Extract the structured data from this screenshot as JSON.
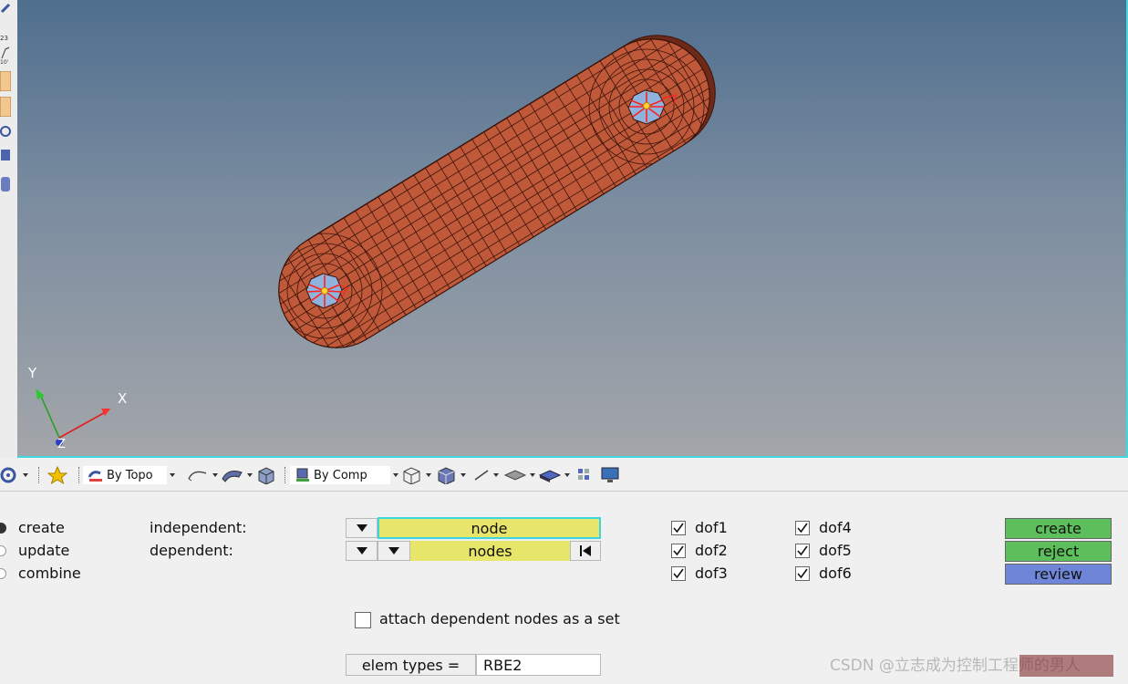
{
  "toolbar": {
    "topo_select": "By Topo",
    "comp_select": "By Comp"
  },
  "panel": {
    "modes": [
      "create",
      "update",
      "combine"
    ],
    "independent_label": "independent:",
    "dependent_label": "dependent:",
    "independent_selector": "node",
    "dependent_selector": "nodes",
    "dofs": [
      "dof1",
      "dof2",
      "dof3",
      "dof4",
      "dof5",
      "dof6"
    ],
    "buttons": {
      "create": "create",
      "reject": "reject",
      "review": "review"
    },
    "attach_label": "attach dependent nodes as a set",
    "elem_types_label": "elem types =",
    "elem_types_value": "RBE2"
  },
  "axes": {
    "x": "X",
    "y": "Y",
    "z": "Z"
  },
  "watermark": "CSDN @立志成为控制工程师的男人",
  "colors": {
    "viewport_top": "#4f6e8e",
    "viewport_bottom": "#a3a6aa",
    "mesh_fill": "#c0593a",
    "selector_yellow": "#e8e66a",
    "create_green": "#5cbf5c",
    "review_blue": "#6f86d8"
  }
}
